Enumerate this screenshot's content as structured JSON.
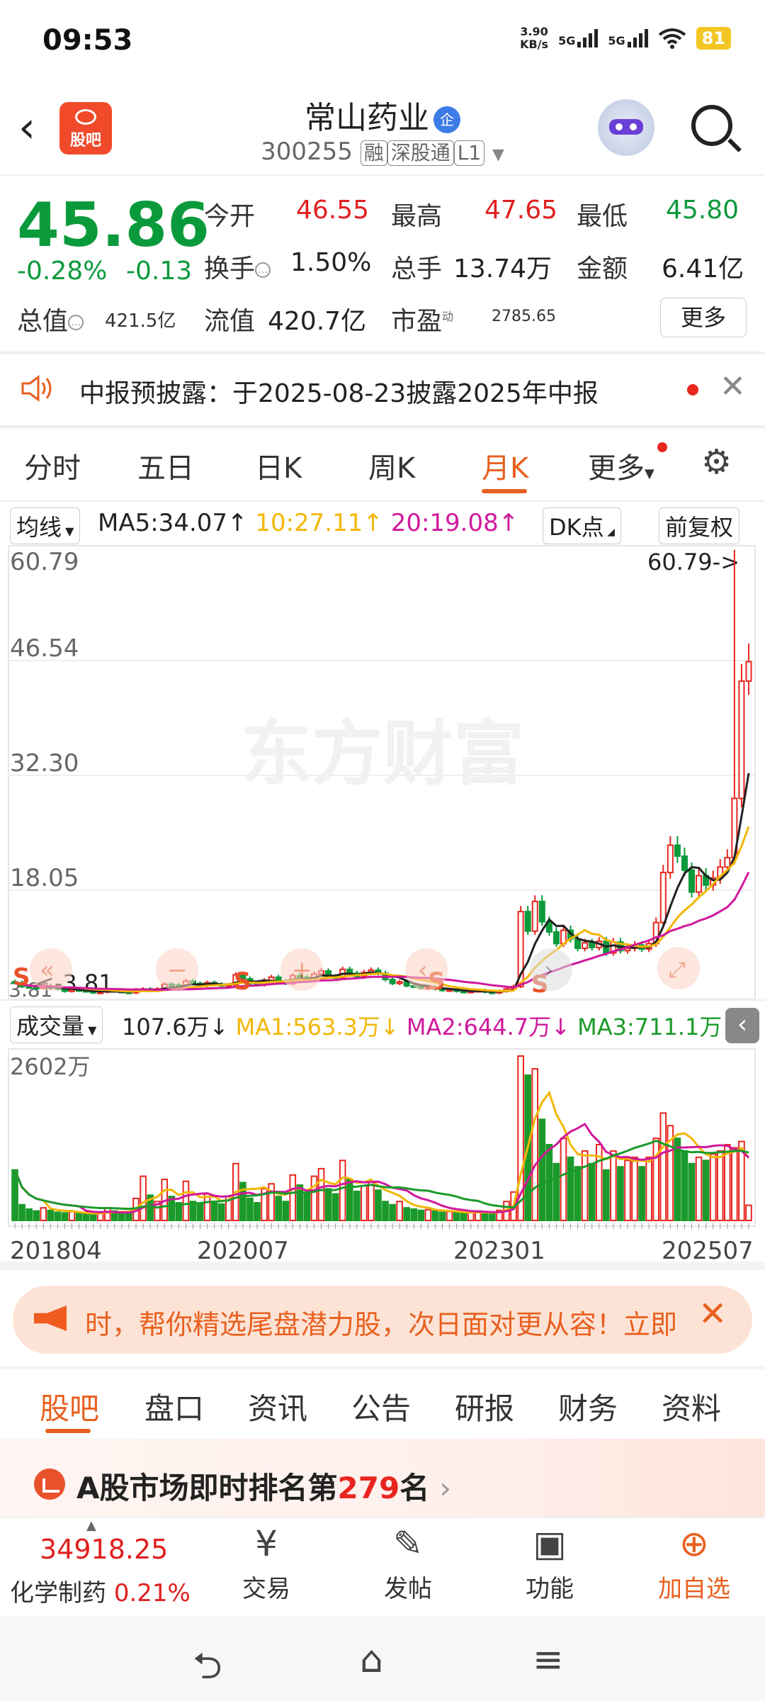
{
  "status": {
    "time": "09:53",
    "netspeed_value": "3.90",
    "netspeed_unit": "KB/s",
    "sig1": "5G",
    "sig2": "5G",
    "battery": "81"
  },
  "header": {
    "logo_text": "股吧",
    "stock_name": "常山药业",
    "badge": "企",
    "code": "300255",
    "tags": [
      "融",
      "深股通",
      "L1"
    ]
  },
  "quote": {
    "price": "45.86",
    "change_pct": "-0.28%",
    "change_amt": "-0.13",
    "open_label": "今开",
    "open": "46.55",
    "high_label": "最高",
    "high": "47.65",
    "low_label": "最低",
    "low": "45.80",
    "turnover_label": "换手",
    "turnover": "1.50%",
    "volume_label": "总手",
    "volume": "13.74万",
    "amount_label": "金额",
    "amount": "6.41亿",
    "mktcap_label": "总值",
    "mktcap": "421.5亿",
    "float_label": "流值",
    "float_cap": "420.7亿",
    "pe_label": "市盈",
    "pe_sup": "动",
    "pe": "2785.65",
    "more": "更多"
  },
  "notice": {
    "text": "中报预披露：于2025-08-23披露2025年中报"
  },
  "period_tabs": [
    "分时",
    "五日",
    "日K",
    "周K",
    "月K",
    "更多"
  ],
  "ma_bar": {
    "select": "均线",
    "ma5": "MA5:34.07",
    "ma10": "10:27.11",
    "ma20": "20:19.08",
    "dk": "DK点",
    "adjust": "前复权"
  },
  "vol_bar": {
    "select": "成交量",
    "vol": "107.6万",
    "ma1": "MA1:563.3万",
    "ma2": "MA2:644.7万",
    "ma3": "MA3:711.1万"
  },
  "chart_data": {
    "type": "candlestick",
    "watermark": "东方财富",
    "price_axis_ticks": [
      "60.79",
      "46.54",
      "32.30",
      "18.05",
      "3.81"
    ],
    "max_label": "60.79->",
    "min_label": "<-3.81",
    "volume_axis_max": "2602万",
    "x_ticks": [
      "201804",
      "202007",
      "202301",
      "202507"
    ],
    "ylim": [
      3.81,
      60.79
    ],
    "closes": [
      5.4,
      4.9,
      4.8,
      4.7,
      5.0,
      4.8,
      4.6,
      4.3,
      4.5,
      4.4,
      4.3,
      4.1,
      4.2,
      4.4,
      4.3,
      4.2,
      4.1,
      4.5,
      4.6,
      4.4,
      4.6,
      5.2,
      5.1,
      4.8,
      5.6,
      5.3,
      5.0,
      5.4,
      5.2,
      5.0,
      5.1,
      6.4,
      5.9,
      5.3,
      5.1,
      5.7,
      6.1,
      5.6,
      5.3,
      6.3,
      6.1,
      5.8,
      6.5,
      6.9,
      6.2,
      6.0,
      7.1,
      6.6,
      6.2,
      6.7,
      7.0,
      6.6,
      5.8,
      5.3,
      5.5,
      5.0,
      4.9,
      4.7,
      4.8,
      4.6,
      4.4,
      4.5,
      4.3,
      4.2,
      4.3,
      4.4,
      4.2,
      4.1,
      4.3,
      4.6,
      4.9,
      14.5,
      12.0,
      15.8,
      13.2,
      11.9,
      10.4,
      12.1,
      11.0,
      9.8,
      10.5,
      9.9,
      10.7,
      9.2,
      10.6,
      9.5,
      9.8,
      10.2,
      9.7,
      10.4,
      13.1,
      19.5,
      23.0,
      21.6,
      19.8,
      17.0,
      19.1,
      17.9,
      18.8,
      20.2,
      21.4,
      29.0,
      44.0,
      46.5
    ],
    "volumes": [
      800,
      250,
      180,
      150,
      200,
      160,
      130,
      120,
      140,
      110,
      100,
      90,
      120,
      200,
      150,
      120,
      110,
      350,
      700,
      400,
      300,
      650,
      380,
      280,
      620,
      300,
      260,
      420,
      300,
      260,
      380,
      900,
      600,
      350,
      280,
      500,
      580,
      380,
      300,
      720,
      560,
      420,
      700,
      820,
      500,
      420,
      950,
      650,
      460,
      550,
      620,
      480,
      300,
      250,
      300,
      200,
      180,
      160,
      170,
      150,
      130,
      140,
      120,
      110,
      130,
      150,
      120,
      110,
      160,
      300,
      450,
      2602,
      2300,
      2400,
      1600,
      1200,
      900,
      1300,
      1000,
      850,
      1100,
      900,
      1200,
      800,
      1100,
      850,
      950,
      1000,
      850,
      1000,
      1300,
      1700,
      1500,
      1300,
      1100,
      900,
      1000,
      950,
      1050,
      1100,
      1200,
      1150,
      1250,
      240
    ],
    "ma_series": [
      {
        "name": "MA5",
        "color": "#222222"
      },
      {
        "name": "MA10",
        "color": "#f2b705"
      },
      {
        "name": "MA20",
        "color": "#d0199c"
      }
    ],
    "vol_ma_series": [
      {
        "name": "MA1",
        "color": "#f2b705"
      },
      {
        "name": "MA2",
        "color": "#d0199c"
      },
      {
        "name": "MA3",
        "color": "#1a9a2a"
      }
    ],
    "markers": [
      "S",
      "S",
      "S",
      "S"
    ]
  },
  "banner": {
    "text": "时，帮你精选尾盘潜力股，次日面对更从容！立即"
  },
  "bottom_tabs": [
    "股吧",
    "盘口",
    "资讯",
    "公告",
    "研报",
    "财务",
    "资料"
  ],
  "rank": {
    "prefix": "A股市场即时排名第",
    "num": "279",
    "suffix": "名"
  },
  "toolbar": {
    "index_value": "34918.25",
    "index_name": "化学制药",
    "index_pct": "0.21%",
    "trade": "交易",
    "post": "发帖",
    "func": "功能",
    "add": "加自选"
  }
}
